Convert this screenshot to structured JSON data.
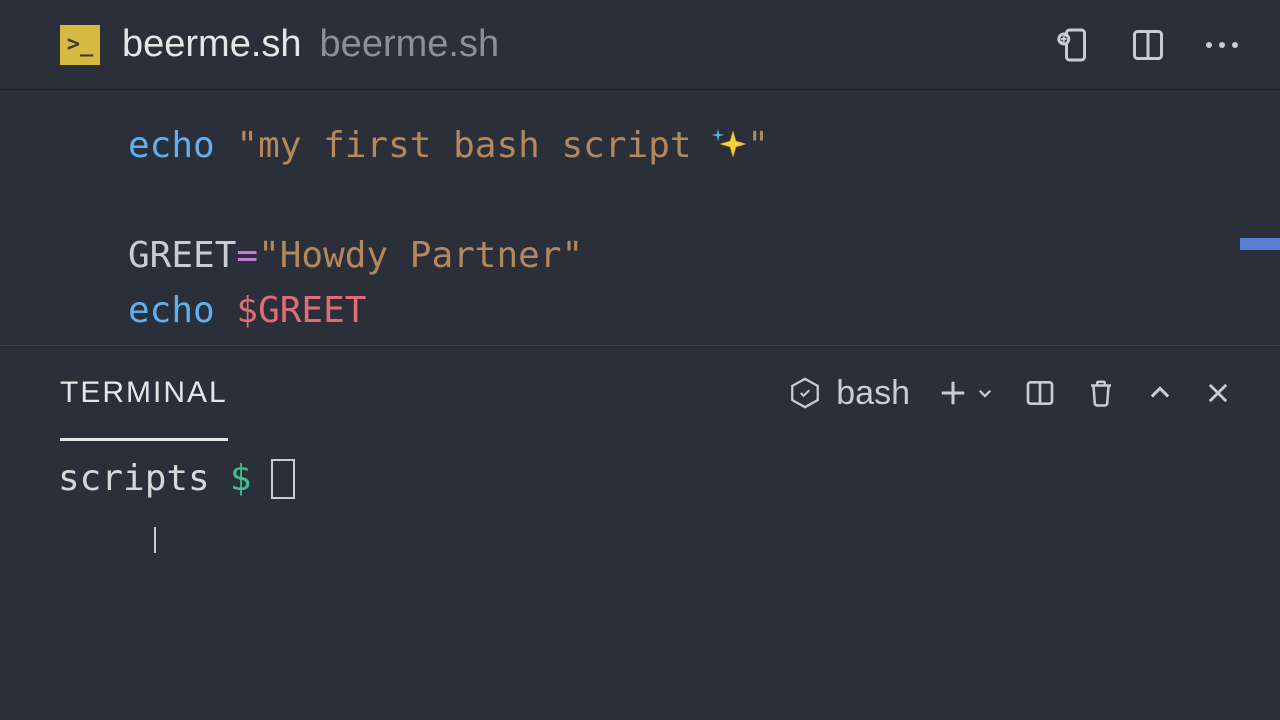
{
  "tab": {
    "filename": "beerme.sh",
    "path": "beerme.sh"
  },
  "code": {
    "line1_cmd": "echo",
    "line1_str_a": "\"my first bash script ",
    "line1_str_b": "\"",
    "line3_var": "GREET",
    "line3_op": "=",
    "line3_str": "\"Howdy Partner\"",
    "line4_cmd": "echo",
    "line4_param": "$GREET"
  },
  "panel": {
    "tab_label": "TERMINAL",
    "shell": "bash"
  },
  "terminal": {
    "cwd": "scripts",
    "prompt": "$"
  }
}
